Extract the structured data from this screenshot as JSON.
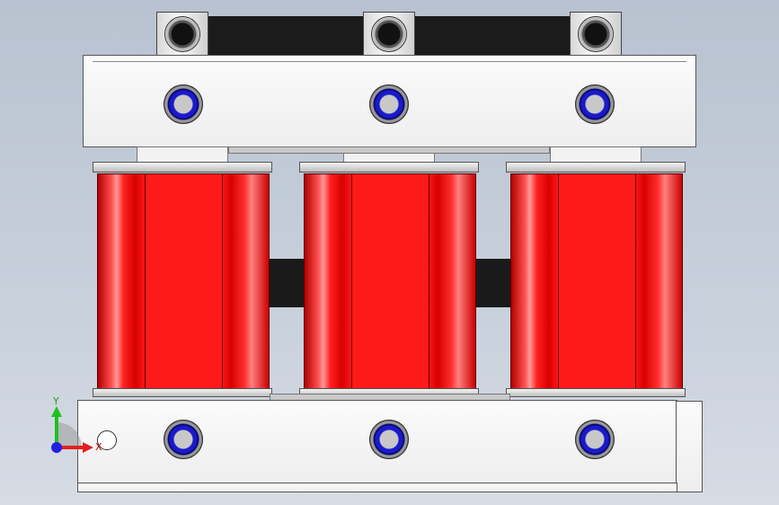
{
  "viewport": {
    "background_top": "#b8c2d0",
    "background_bottom": "#d6dce4"
  },
  "model": {
    "coil_color": "#ff1a1a",
    "bolt_color": "#1a1acc",
    "core_color": "#1a1a1a",
    "plate_color": "#f2f2f2",
    "terminals": 3,
    "coils": 3
  },
  "triad": {
    "x_label": "X",
    "y_label": "Y",
    "x_color": "#e02020",
    "y_color": "#20c020",
    "z_color": "#2020e0"
  }
}
